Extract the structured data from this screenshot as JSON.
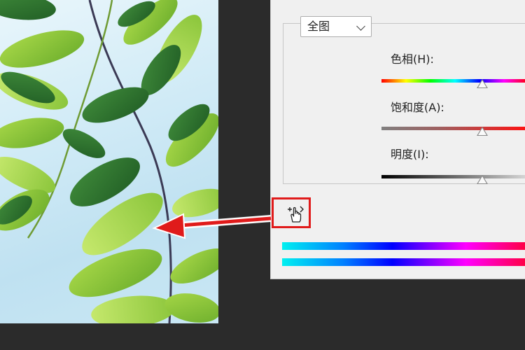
{
  "dialog": {
    "range_select": {
      "value": "全图",
      "chevron_icon": "chevron-down-icon"
    },
    "hue": {
      "label": "色相(H):",
      "track_colors": [
        "#ff0000",
        "#ffff00",
        "#00ff00",
        "#00ffff",
        "#0000ff",
        "#ff00ff",
        "#ff0000"
      ]
    },
    "saturation": {
      "label": "饱和度(A):",
      "track_colors": [
        "#7f7f7f",
        "#ff0000"
      ]
    },
    "lightness": {
      "label": "明度(I):",
      "track_colors": [
        "#000000",
        "#ffffff"
      ]
    },
    "targeted_adjust_tool": {
      "icon": "hand-scrubby-icon"
    },
    "spectrum_bars": [
      "input-spectrum",
      "output-spectrum"
    ]
  },
  "annotation": {
    "highlight_color": "#e01b1b",
    "arrow_color": "#e01b1b"
  }
}
